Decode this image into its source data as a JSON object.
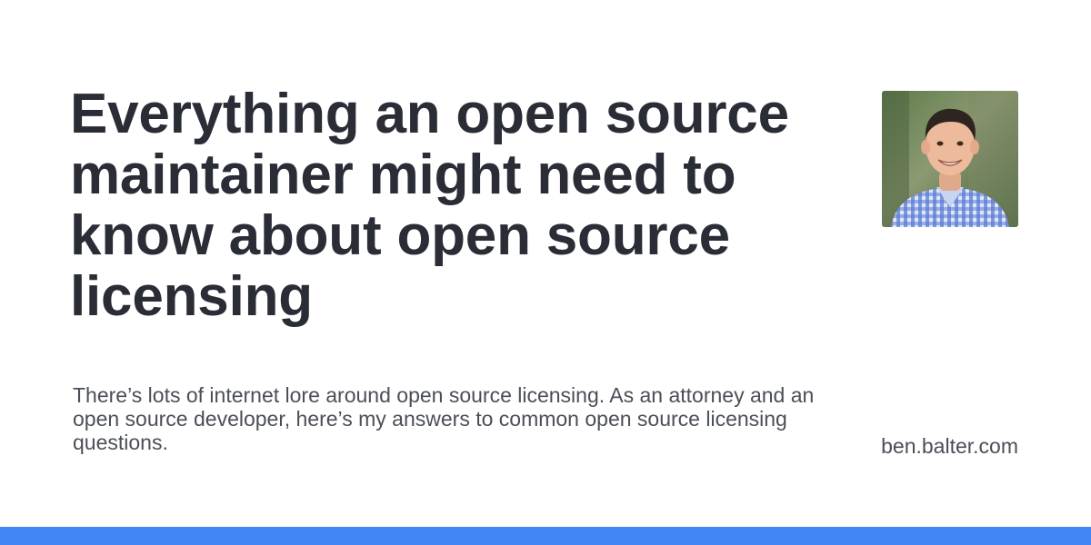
{
  "card": {
    "title": "Everything an open source maintainer might need to know about open source licensing",
    "description": "There’s lots of internet lore around open source licensing. As an attorney and an open source developer, here’s my answers to common open source licensing questions.",
    "site": "ben.balter.com",
    "avatar_icon": "author-photo",
    "accent_color": "#4285f4"
  }
}
